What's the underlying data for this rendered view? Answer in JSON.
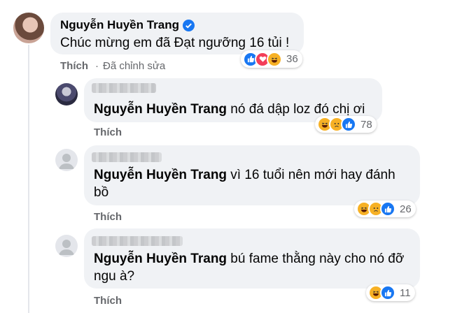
{
  "main_comment": {
    "author": "Nguyễn Huyền Trang",
    "text": "Chúc mừng em đã Đạt ngưỡng 16 tủi !",
    "reaction_count": "36",
    "reactions": [
      "like-icon",
      "love-icon",
      "haha-icon"
    ],
    "action_label": "Thích",
    "separator": "·",
    "edited_label": "Đã chỉnh sửa"
  },
  "replies": [
    {
      "mention": "Nguyễn Huyền Trang",
      "text": " nó đá dập loz đó chị ơi",
      "reaction_count": "78",
      "reactions": [
        "haha-icon",
        "sad-icon",
        "like-icon"
      ],
      "action_label": "Thích"
    },
    {
      "mention": "Nguyễn Huyền Trang",
      "text": " vì 16 tuổi nên mới hay đánh bồ",
      "reaction_count": "26",
      "reactions": [
        "haha-icon",
        "sad-icon",
        "like-icon"
      ],
      "action_label": "Thích"
    },
    {
      "mention": "Nguyễn Huyền Trang",
      "text": " bú fame thằng này cho nó đỡ ngu à?",
      "reaction_count": "11",
      "reactions": [
        "haha-icon",
        "like-icon"
      ],
      "action_label": "Thích"
    }
  ],
  "colors": {
    "bubble": "#f0f2f5",
    "like": "#1877f2",
    "love": "#f33e58",
    "haha": "#f7b125",
    "verified": "#1877f2",
    "muted": "#65676b"
  }
}
